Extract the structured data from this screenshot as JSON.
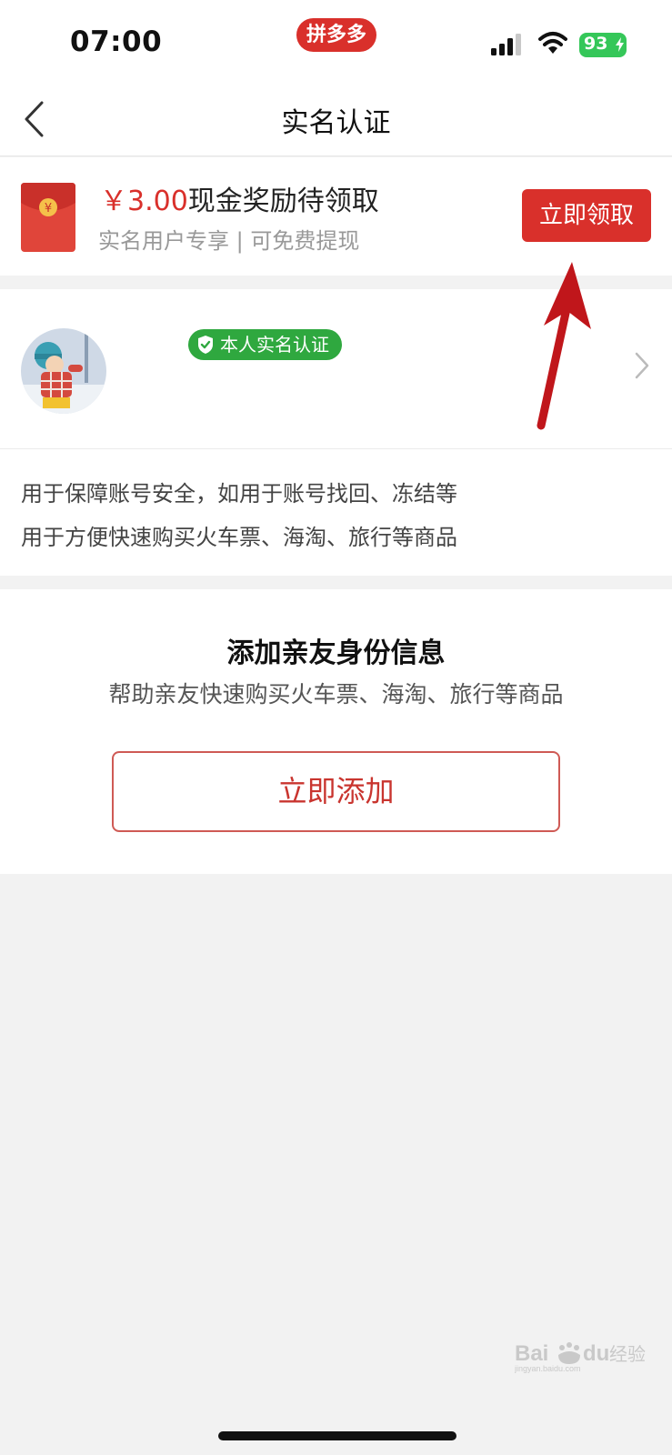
{
  "status_bar": {
    "time": "07:00",
    "app_pill": "拼多多",
    "battery": "93"
  },
  "header": {
    "title": "实名认证"
  },
  "reward": {
    "amount": "￥3.00",
    "title_suffix": "现金奖励待领取",
    "subtitle": "实名用户专享 | 可免费提现",
    "button": "立即领取",
    "accent_color": "#d9302b"
  },
  "verification": {
    "badge": "本人实名认证",
    "usage_lines": [
      "用于保障账号安全，如用于账号找回、冻结等",
      "用于方便快速购买火车票、海淘、旅行等商品"
    ],
    "badge_color": "#2fa83f"
  },
  "family": {
    "title": "添加亲友身份信息",
    "subtitle": "帮助亲友快速购买火车票、海淘、旅行等商品",
    "button": "立即添加"
  },
  "watermark": {
    "text": "Baidu 经验",
    "sub": "jingyan.baidu.com"
  },
  "icons": {
    "back": "back-arrow-icon",
    "signal": "cellular-signal-icon",
    "wifi": "wifi-icon",
    "envelope": "red-envelope-icon",
    "shield": "shield-check-icon",
    "chevron": "chevron-right-icon"
  }
}
